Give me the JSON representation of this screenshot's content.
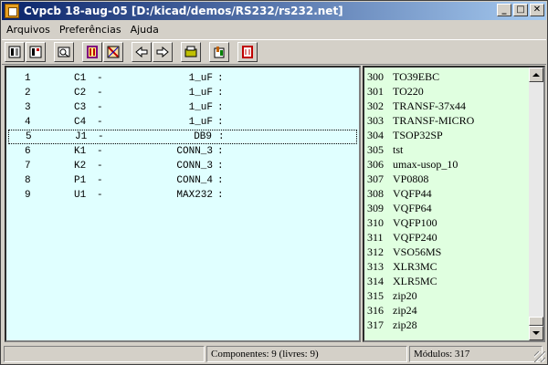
{
  "window": {
    "title": "Cvpcb 18-aug-05 [D:/kicad/demos/RS232/rs232.net]",
    "controls": {
      "minimize": "_",
      "maximize": "□",
      "close": "✕"
    }
  },
  "menu": [
    "Arquivos",
    "Preferências",
    "Ajuda"
  ],
  "toolbar": {
    "icons": [
      "netlist-open-icon",
      "netlist-save-icon",
      "footprint-view-icon",
      "library-config-icon",
      "auto-associate-icon",
      "previous-icon",
      "next-icon",
      "footprint-3d-icon",
      "assign-icon",
      "delete-assoc-icon"
    ]
  },
  "components": [
    {
      "index": "1",
      "ref": "C1",
      "value": "1_uF"
    },
    {
      "index": "2",
      "ref": "C2",
      "value": "1_uF"
    },
    {
      "index": "3",
      "ref": "C3",
      "value": "1_uF"
    },
    {
      "index": "4",
      "ref": "C4",
      "value": "1_uF"
    },
    {
      "index": "5",
      "ref": "J1",
      "value": "DB9"
    },
    {
      "index": "6",
      "ref": "K1",
      "value": "CONN_3"
    },
    {
      "index": "7",
      "ref": "K2",
      "value": "CONN_3"
    },
    {
      "index": "8",
      "ref": "P1",
      "value": "CONN_4"
    },
    {
      "index": "9",
      "ref": "U1",
      "value": "MAX232"
    }
  ],
  "selected_component": "5",
  "modules": [
    {
      "num": "300",
      "name": "TO39EBC"
    },
    {
      "num": "301",
      "name": "TO220"
    },
    {
      "num": "302",
      "name": "TRANSF-37x44"
    },
    {
      "num": "303",
      "name": "TRANSF-MICRO"
    },
    {
      "num": "304",
      "name": "TSOP32SP"
    },
    {
      "num": "305",
      "name": "tst"
    },
    {
      "num": "306",
      "name": "umax-usop_10"
    },
    {
      "num": "307",
      "name": "VP0808"
    },
    {
      "num": "308",
      "name": "VQFP44"
    },
    {
      "num": "309",
      "name": "VQFP64"
    },
    {
      "num": "310",
      "name": "VQFP100"
    },
    {
      "num": "311",
      "name": "VQFP240"
    },
    {
      "num": "312",
      "name": "VSO56MS"
    },
    {
      "num": "313",
      "name": "XLR3MC"
    },
    {
      "num": "314",
      "name": "XLR5MC"
    },
    {
      "num": "315",
      "name": "zip20"
    },
    {
      "num": "316",
      "name": "zip24"
    },
    {
      "num": "317",
      "name": "zip28"
    }
  ],
  "status": {
    "left": "",
    "components": "Componentes: 9 (livres: 9)",
    "modules": "Módulos: 317"
  },
  "colors": {
    "component_list_bg": "#e0ffff",
    "module_list_bg": "#e0ffe0",
    "titlebar_start": "#0a246a",
    "titlebar_end": "#a6caf0"
  }
}
